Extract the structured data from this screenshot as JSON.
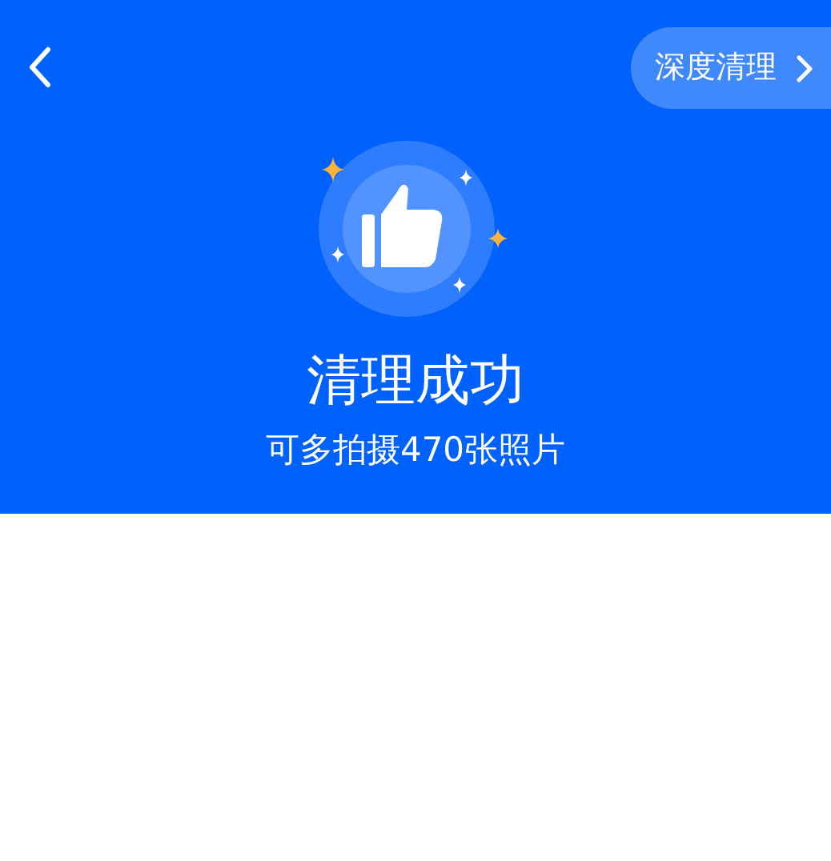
{
  "header": {
    "action_button": {
      "label": "深度清理"
    }
  },
  "result": {
    "title": "清理成功",
    "subtitle": "可多拍摄470张照片"
  }
}
